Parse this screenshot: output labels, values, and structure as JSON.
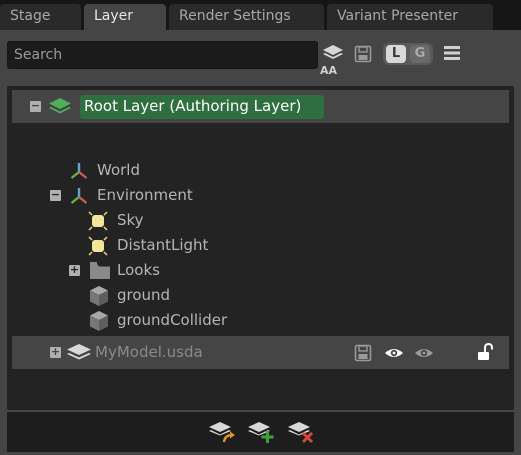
{
  "tabs": [
    {
      "label": "Stage"
    },
    {
      "label": "Layer"
    },
    {
      "label": "Render Settings"
    },
    {
      "label": "Variant Presenter"
    }
  ],
  "toolbar": {
    "search_placeholder": "Search",
    "aa_label": "AA",
    "l_toggle": "L",
    "g_toggle": "G"
  },
  "root_layer": {
    "label": "Root Layer (Authoring Layer)",
    "expander": "−",
    "highlight_color": "#2f6e3e"
  },
  "prims": [
    {
      "label": "World",
      "icon": "xform-icon"
    },
    {
      "label": "Environment",
      "icon": "xform-icon",
      "expander": "−"
    },
    {
      "label": "Sky",
      "icon": "light-icon"
    },
    {
      "label": "DistantLight",
      "icon": "light-icon"
    },
    {
      "label": "Looks",
      "icon": "folder-icon",
      "expander": "+"
    },
    {
      "label": "ground",
      "icon": "mesh-cube-icon"
    },
    {
      "label": "groundCollider",
      "icon": "mesh-cube-icon"
    }
  ],
  "sublayer": {
    "label": "MyModel.usda",
    "expander": "+"
  },
  "colors": {
    "background": "#1f1f1f",
    "panel": "#454545",
    "tree": "#232323",
    "light_yellow": "#f1e59a",
    "add_green": "#3aa33a",
    "remove_red": "#d04a3a",
    "insert_orange": "#e0952a"
  }
}
